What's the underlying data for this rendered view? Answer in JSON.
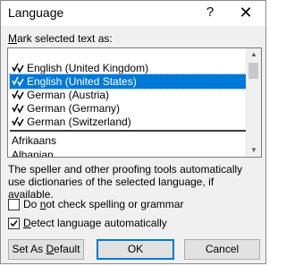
{
  "dialog": {
    "title": "Language",
    "help_glyph": "?",
    "close_glyph": "✕"
  },
  "mark_label_pre": "",
  "mark_label_u": "M",
  "mark_label_post": "ark selected text as:",
  "languages_recent": [
    {
      "label": "English (United Kingdom)",
      "selected": false
    },
    {
      "label": "English (United States)",
      "selected": true
    },
    {
      "label": "German (Austria)",
      "selected": false
    },
    {
      "label": "German (Germany)",
      "selected": false
    },
    {
      "label": "German (Switzerland)",
      "selected": false
    }
  ],
  "languages_all": [
    "Afrikaans",
    "Albanian"
  ],
  "info_text": "The speller and other proofing tools automatically use dictionaries of the selected language, if available.",
  "checkbox_no_check": {
    "pre": "Do ",
    "u": "n",
    "post": "ot check spelling or grammar",
    "checked": false
  },
  "checkbox_detect": {
    "pre": "",
    "u": "D",
    "post": "etect language automatically",
    "checked": true
  },
  "buttons": {
    "set_default_pre": "Set As ",
    "set_default_u": "D",
    "set_default_post": "efault",
    "ok": "OK",
    "cancel": "Cancel"
  },
  "icons": {
    "check_icon": "proofing-check-icon",
    "scroll_up": "▲",
    "scroll_down": "▼"
  },
  "colors": {
    "selection": "#0078d7",
    "dialog_bg": "#f0f0f0"
  }
}
